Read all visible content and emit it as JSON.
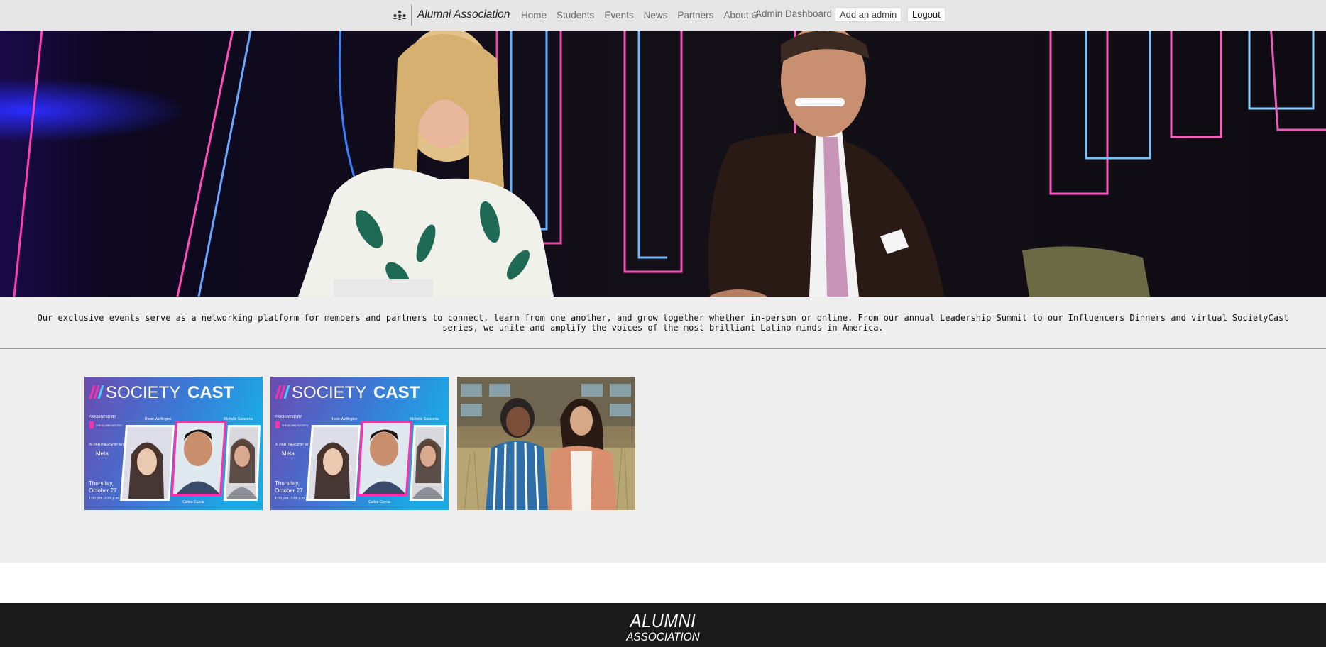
{
  "navbar": {
    "brand": "Alumni Association",
    "links": [
      "Home",
      "Students",
      "Events",
      "News",
      "Partners",
      "About"
    ],
    "admin_dashboard": "Admin Dashboard",
    "add_admin": "Add an admin",
    "logout": "Logout"
  },
  "intro": {
    "text": "Our exclusive events serve as a networking platform for members and partners to connect, learn from one another, and grow together whether in-person or online. From our annual Leadership Summit to our Influencers Dinners and virtual SocietyCast series, we unite and amplify the voices of the most brilliant Latino minds in America."
  },
  "events": [
    {
      "title_a": "SOCIETY",
      "title_b": "CAST",
      "presented_by": "PRESENTED BY",
      "society": "THE ALUMNI SOCIETY",
      "partnership": "IN PARTNERSHIP WITH",
      "partner": "Meta",
      "day": "Thursday,",
      "date": "October 27",
      "time": "1:00 p.m.-2:00 p.m. ET",
      "speaker_1": "Rocio Wellington",
      "speaker_2": "Michelle Saracena",
      "speaker_3": "Carlos Garcia"
    },
    {
      "title_a": "SOCIETY",
      "title_b": "CAST",
      "presented_by": "PRESENTED BY",
      "society": "THE ALUMNI SOCIETY",
      "partnership": "IN PARTNERSHIP WITH",
      "partner": "Meta",
      "day": "Thursday,",
      "date": "October 27",
      "time": "1:00 p.m.-2:00 p.m. ET",
      "speaker_1": "Rocio Wellington",
      "speaker_2": "Michelle Saracena",
      "speaker_3": "Carlos Garcia"
    }
  ],
  "footer": {
    "logo_line1": "ALUMNI",
    "logo_line2": "ASSOCIATION"
  },
  "colors": {
    "navbar_bg": "#e6e6e6",
    "section_bg": "#eeeeee",
    "footer_bg": "#1a1a1a",
    "societycast_gradient_start": "#6a4bb0",
    "societycast_gradient_end": "#1ba9e6"
  },
  "icons": {
    "brand": "people-network-icon",
    "about_toggle": "chevron-down-icon"
  }
}
